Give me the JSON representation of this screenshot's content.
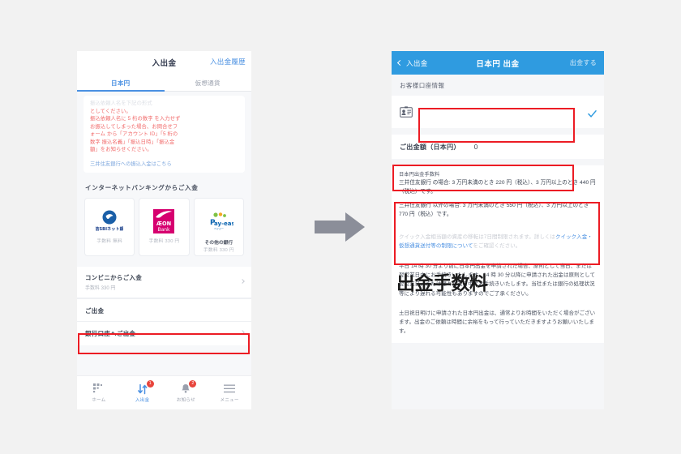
{
  "left_phone": {
    "header": {
      "title": "入出金",
      "history_link": "入出金履歴"
    },
    "tabs": [
      {
        "label": "日本円",
        "active": true
      },
      {
        "label": "仮想通貨",
        "active": false
      }
    ],
    "notice": {
      "faded_line": "振込依頼人名を下記の形式",
      "lines": [
        "としてください。",
        "振込依頼人名に 5 桁の数字 を入力せず",
        "お振込してしまった場合、お問合せフ",
        "ォーム から「アカウント ID」「5 桁の",
        "数字 振込名義」「振込日時」「振込金",
        "額」をお知らせください。"
      ],
      "link": "三井住友銀行への振込入金はこちら"
    },
    "internet_banking": {
      "heading": "インターネットバンキングからご入金",
      "cards": [
        {
          "logo": "sbi-net-bank-logo",
          "name": "住信SBIネット銀行",
          "fee": "手数料 無料"
        },
        {
          "logo": "aeon-bank-logo",
          "name": "AEON Bank",
          "fee": "手数料 330 円"
        },
        {
          "logo": "pay-easy-logo",
          "name": "その他の銀行",
          "fee": "手数料 330 円"
        }
      ]
    },
    "konbini": {
      "title": "コンビニからご入金",
      "sub": "手数料 330 円"
    },
    "withdraw_group": {
      "heading": "ご出金",
      "row_label": "銀行口座へご出金"
    },
    "bottom_nav": [
      {
        "icon": "home-icon",
        "label": "ホーム",
        "badge": "",
        "active": false
      },
      {
        "icon": "transfer-icon",
        "label": "入出金",
        "badge": "1",
        "active": true
      },
      {
        "icon": "bell-icon",
        "label": "お知らせ",
        "badge": "2",
        "active": false
      },
      {
        "icon": "menu-icon",
        "label": "メニュー",
        "badge": "",
        "active": false
      }
    ]
  },
  "arrow": {
    "name": "flow-arrow",
    "color": "#8b8e99"
  },
  "right_phone": {
    "header": {
      "back_label": "入出金",
      "title": "日本円 出金",
      "action": "出金する"
    },
    "account_section": {
      "label": "お客様口座情報",
      "icon": "id-card-icon",
      "value_masked": "",
      "check_icon": "check-icon"
    },
    "amount": {
      "label": "ご出金額（日本円）",
      "value": "0"
    },
    "fee_box": {
      "title": "日本円出金手数料",
      "paragraphs": [
        "三井住友銀行 の場合: 3 万円未満のとき 220 円（税込）、3 万円以上のとき 440 円（税込）です。",
        "三井住友銀行 以外の場合: 3 万円未満のとき 550 円（税込）、3 万円以上のとき 770 円（税込）です。"
      ]
    },
    "notes": {
      "muted_text_head": "クイック入金相当額の資産の移転",
      "muted_text_rest": "は7日間制限されます。詳しくは",
      "muted_link_1": "クイ",
      "muted_link_2": "ック入金・仮想通貨送付等の制限について",
      "muted_tail": "をご確認ください。",
      "paragraph_1": "平日 14 時 30 分より前に日本円出金を申請された場合、原則として当日、または翌営業日中にお手続きいたします。14 時 30 分以降に申請された出金は原則として翌営業日、または翌々営業日中にお手続きいたします。当社または銀行の処理状況等により遅れる可能性もありますのでご了承ください。",
      "paragraph_2": "土日祝日明けに申請された日本円出金は、通常よりお時間をいただく場合がございます。出金のご依頼は時間に余裕をもって行っていただきますようお願いいたします。"
    }
  },
  "overlay": {
    "title": "出金手数料"
  },
  "highlights": {
    "color": "#ec1c24",
    "boxes": [
      {
        "name": "highlight-withdraw-row"
      },
      {
        "name": "highlight-account-field"
      },
      {
        "name": "highlight-amount-field"
      },
      {
        "name": "highlight-fee-box"
      }
    ]
  }
}
